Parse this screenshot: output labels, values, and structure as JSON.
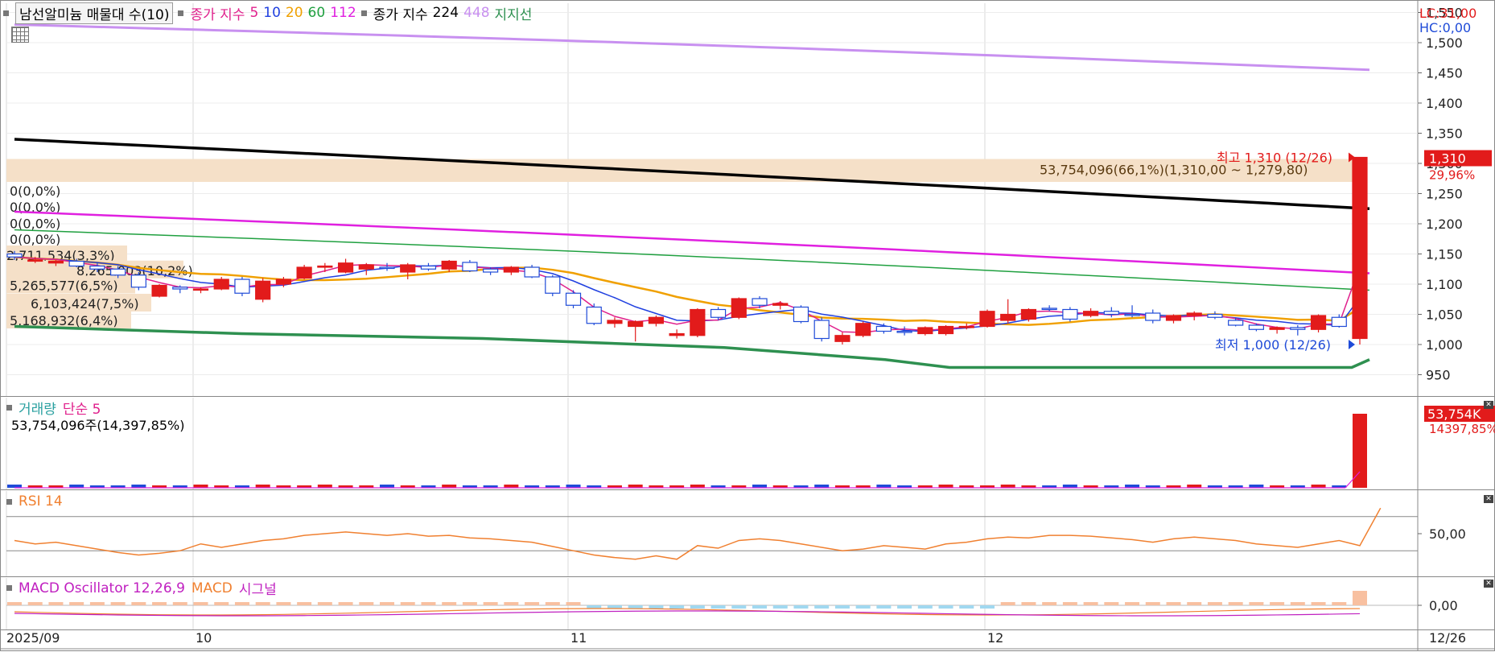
{
  "legend": {
    "stock_box": "남선알미늄 매물대 수(10)",
    "ma_label": "종가 지수",
    "ma_periods": [
      "5",
      "10",
      "20",
      "60",
      "112"
    ],
    "ma_colors": [
      "#e0208c",
      "#2040e0",
      "#f0a000",
      "#20a040",
      "#e020e0"
    ],
    "ma2_label": "종가 지수",
    "ma2_periods": [
      "224",
      "448"
    ],
    "ma2_colors": [
      "#000000",
      "#c890f0"
    ],
    "support_label": "지지선"
  },
  "top_right": {
    "lc": "LC:31,00",
    "hc": "HC:0,00"
  },
  "price_axis": {
    "ticks": [
      "1,550",
      "1,500",
      "1,450",
      "1,400",
      "1,350",
      "1,300",
      "1,250",
      "1,200",
      "1,150",
      "1,100",
      "1,050",
      "1,000",
      "950"
    ],
    "current_price": "1,310",
    "current_pct": "29,96%"
  },
  "volume_profile": [
    {
      "label": "0(0,0%)"
    },
    {
      "label": "0(0,0%)"
    },
    {
      "label": "0(0,0%)"
    },
    {
      "label": "0(0,0%)"
    },
    {
      "label": "2,711,534(3,3%)"
    },
    {
      "label": "8,265,003(10,2%)"
    },
    {
      "label": "5,265,577(6,5%)"
    },
    {
      "label": "6,103,424(7,5%)"
    },
    {
      "label": "5,168,932(6,4%)"
    },
    {
      "label": "53,754,096(66,1%)(1,310,00 ~ 1,279,80)"
    }
  ],
  "annotations": {
    "high": "최고 1,310 (12/26)",
    "low": "최저 1,000 (12/26)"
  },
  "volume_panel": {
    "title": "거래량",
    "ma_label": "단순 5",
    "value_text": "53,754,096주(14,397,85%)",
    "axis_value": "53,754K",
    "axis_pct": "14397,85%"
  },
  "rsi_panel": {
    "title": "RSI 14",
    "tick": "50,00"
  },
  "macd_panel": {
    "title": "MACD Oscillator 12,26,9",
    "macd_label": "MACD",
    "signal_label": "시그널",
    "tick": "0,00"
  },
  "x_axis": {
    "labels": [
      "2025/09",
      "10",
      "11",
      "12"
    ],
    "last_date": "12/26"
  },
  "colors": {
    "up": "#e21b1b",
    "down": "#1f4bd8",
    "rsi": "#f08030",
    "macd_pos": "#f8c0a0",
    "macd_neg": "#a0d8f0",
    "ma224": "#000000",
    "ma448": "#c890f0",
    "ma112": "#e020e0",
    "ma60": "#20a040",
    "ma20": "#f0a000",
    "ma10": "#2040e0",
    "ma5": "#e0208c",
    "support": "#2e9050",
    "profile": "#f5e0c8"
  },
  "chart_data": {
    "type": "candlestick",
    "title": "남선알미늄 매물대 수(10)",
    "ylim": [
      920,
      1560
    ],
    "dates": [
      "12/26"
    ],
    "candles": [
      {
        "o": 1150,
        "h": 1155,
        "l": 1140,
        "c": 1145
      },
      {
        "o": 1140,
        "h": 1145,
        "l": 1135,
        "c": 1140
      },
      {
        "o": 1135,
        "h": 1140,
        "l": 1130,
        "c": 1138
      },
      {
        "o": 1138,
        "h": 1142,
        "l": 1128,
        "c": 1130
      },
      {
        "o": 1130,
        "h": 1135,
        "l": 1120,
        "c": 1125
      },
      {
        "o": 1125,
        "h": 1130,
        "l": 1110,
        "c": 1115
      },
      {
        "o": 1115,
        "h": 1120,
        "l": 1090,
        "c": 1095
      },
      {
        "o": 1080,
        "h": 1100,
        "l": 1078,
        "c": 1098
      },
      {
        "o": 1095,
        "h": 1098,
        "l": 1085,
        "c": 1092
      },
      {
        "o": 1090,
        "h": 1095,
        "l": 1085,
        "c": 1092
      },
      {
        "o": 1092,
        "h": 1112,
        "l": 1090,
        "c": 1108
      },
      {
        "o": 1108,
        "h": 1112,
        "l": 1080,
        "c": 1085
      },
      {
        "o": 1075,
        "h": 1110,
        "l": 1070,
        "c": 1105
      },
      {
        "o": 1100,
        "h": 1112,
        "l": 1095,
        "c": 1108
      },
      {
        "o": 1110,
        "h": 1132,
        "l": 1108,
        "c": 1128
      },
      {
        "o": 1128,
        "h": 1135,
        "l": 1120,
        "c": 1130
      },
      {
        "o": 1120,
        "h": 1142,
        "l": 1118,
        "c": 1135
      },
      {
        "o": 1125,
        "h": 1135,
        "l": 1115,
        "c": 1132
      },
      {
        "o": 1128,
        "h": 1135,
        "l": 1122,
        "c": 1126
      },
      {
        "o": 1120,
        "h": 1135,
        "l": 1108,
        "c": 1132
      },
      {
        "o": 1130,
        "h": 1135,
        "l": 1122,
        "c": 1125
      },
      {
        "o": 1125,
        "h": 1140,
        "l": 1120,
        "c": 1138
      },
      {
        "o": 1136,
        "h": 1140,
        "l": 1120,
        "c": 1122
      },
      {
        "o": 1125,
        "h": 1128,
        "l": 1115,
        "c": 1120
      },
      {
        "o": 1120,
        "h": 1130,
        "l": 1115,
        "c": 1128
      },
      {
        "o": 1128,
        "h": 1132,
        "l": 1110,
        "c": 1112
      },
      {
        "o": 1112,
        "h": 1115,
        "l": 1080,
        "c": 1085
      },
      {
        "o": 1085,
        "h": 1090,
        "l": 1060,
        "c": 1065
      },
      {
        "o": 1062,
        "h": 1068,
        "l": 1032,
        "c": 1035
      },
      {
        "o": 1035,
        "h": 1045,
        "l": 1028,
        "c": 1040
      },
      {
        "o": 1030,
        "h": 1040,
        "l": 1005,
        "c": 1038
      },
      {
        "o": 1035,
        "h": 1048,
        "l": 1030,
        "c": 1045
      },
      {
        "o": 1015,
        "h": 1025,
        "l": 1010,
        "c": 1018
      },
      {
        "o": 1015,
        "h": 1060,
        "l": 1012,
        "c": 1058
      },
      {
        "o": 1058,
        "h": 1062,
        "l": 1040,
        "c": 1045
      },
      {
        "o": 1045,
        "h": 1078,
        "l": 1042,
        "c": 1076
      },
      {
        "o": 1076,
        "h": 1080,
        "l": 1060,
        "c": 1065
      },
      {
        "o": 1065,
        "h": 1072,
        "l": 1058,
        "c": 1068
      },
      {
        "o": 1062,
        "h": 1065,
        "l": 1035,
        "c": 1038
      },
      {
        "o": 1040,
        "h": 1045,
        "l": 1005,
        "c": 1010
      },
      {
        "o": 1005,
        "h": 1020,
        "l": 1000,
        "c": 1015
      },
      {
        "o": 1015,
        "h": 1038,
        "l": 1012,
        "c": 1035
      },
      {
        "o": 1030,
        "h": 1035,
        "l": 1018,
        "c": 1022
      },
      {
        "o": 1022,
        "h": 1030,
        "l": 1015,
        "c": 1020
      },
      {
        "o": 1018,
        "h": 1030,
        "l": 1015,
        "c": 1028
      },
      {
        "o": 1018,
        "h": 1032,
        "l": 1015,
        "c": 1030
      },
      {
        "o": 1028,
        "h": 1035,
        "l": 1025,
        "c": 1030
      },
      {
        "o": 1030,
        "h": 1058,
        "l": 1028,
        "c": 1055
      },
      {
        "o": 1040,
        "h": 1075,
        "l": 1035,
        "c": 1050
      },
      {
        "o": 1042,
        "h": 1060,
        "l": 1038,
        "c": 1058
      },
      {
        "o": 1060,
        "h": 1065,
        "l": 1055,
        "c": 1058
      },
      {
        "o": 1058,
        "h": 1062,
        "l": 1038,
        "c": 1042
      },
      {
        "o": 1048,
        "h": 1060,
        "l": 1045,
        "c": 1055
      },
      {
        "o": 1055,
        "h": 1062,
        "l": 1045,
        "c": 1050
      },
      {
        "o": 1050,
        "h": 1065,
        "l": 1045,
        "c": 1048
      },
      {
        "o": 1052,
        "h": 1058,
        "l": 1035,
        "c": 1040
      },
      {
        "o": 1040,
        "h": 1050,
        "l": 1035,
        "c": 1048
      },
      {
        "o": 1048,
        "h": 1055,
        "l": 1040,
        "c": 1052
      },
      {
        "o": 1050,
        "h": 1055,
        "l": 1042,
        "c": 1045
      },
      {
        "o": 1040,
        "h": 1045,
        "l": 1030,
        "c": 1032
      },
      {
        "o": 1032,
        "h": 1035,
        "l": 1022,
        "c": 1025
      },
      {
        "o": 1025,
        "h": 1030,
        "l": 1018,
        "c": 1028
      },
      {
        "o": 1028,
        "h": 1032,
        "l": 1015,
        "c": 1025
      },
      {
        "o": 1025,
        "h": 1050,
        "l": 1020,
        "c": 1048
      },
      {
        "o": 1045,
        "h": 1050,
        "l": 1028,
        "c": 1030
      },
      {
        "o": 1010,
        "h": 1310,
        "l": 1000,
        "c": 1310
      }
    ],
    "ma224": [
      1340,
      1225
    ],
    "ma448": [
      1530,
      1455
    ],
    "ma112": [
      1220,
      1118
    ],
    "ma60": [
      1190,
      1090
    ],
    "support": [
      1030,
      950
    ],
    "rsi": [
      42,
      38,
      40,
      36,
      32,
      28,
      25,
      27,
      30,
      38,
      34,
      38,
      42,
      44,
      48,
      50,
      52,
      50,
      48,
      50,
      47,
      48,
      45,
      44,
      42,
      40,
      35,
      30,
      25,
      22,
      20,
      24,
      20,
      36,
      33,
      42,
      44,
      42,
      38,
      34,
      30,
      32,
      36,
      34,
      32,
      38,
      40,
      44,
      46,
      45,
      48,
      48,
      47,
      45,
      43,
      40,
      44,
      46,
      44,
      42,
      38,
      36,
      34,
      38,
      42,
      36,
      80
    ]
  }
}
